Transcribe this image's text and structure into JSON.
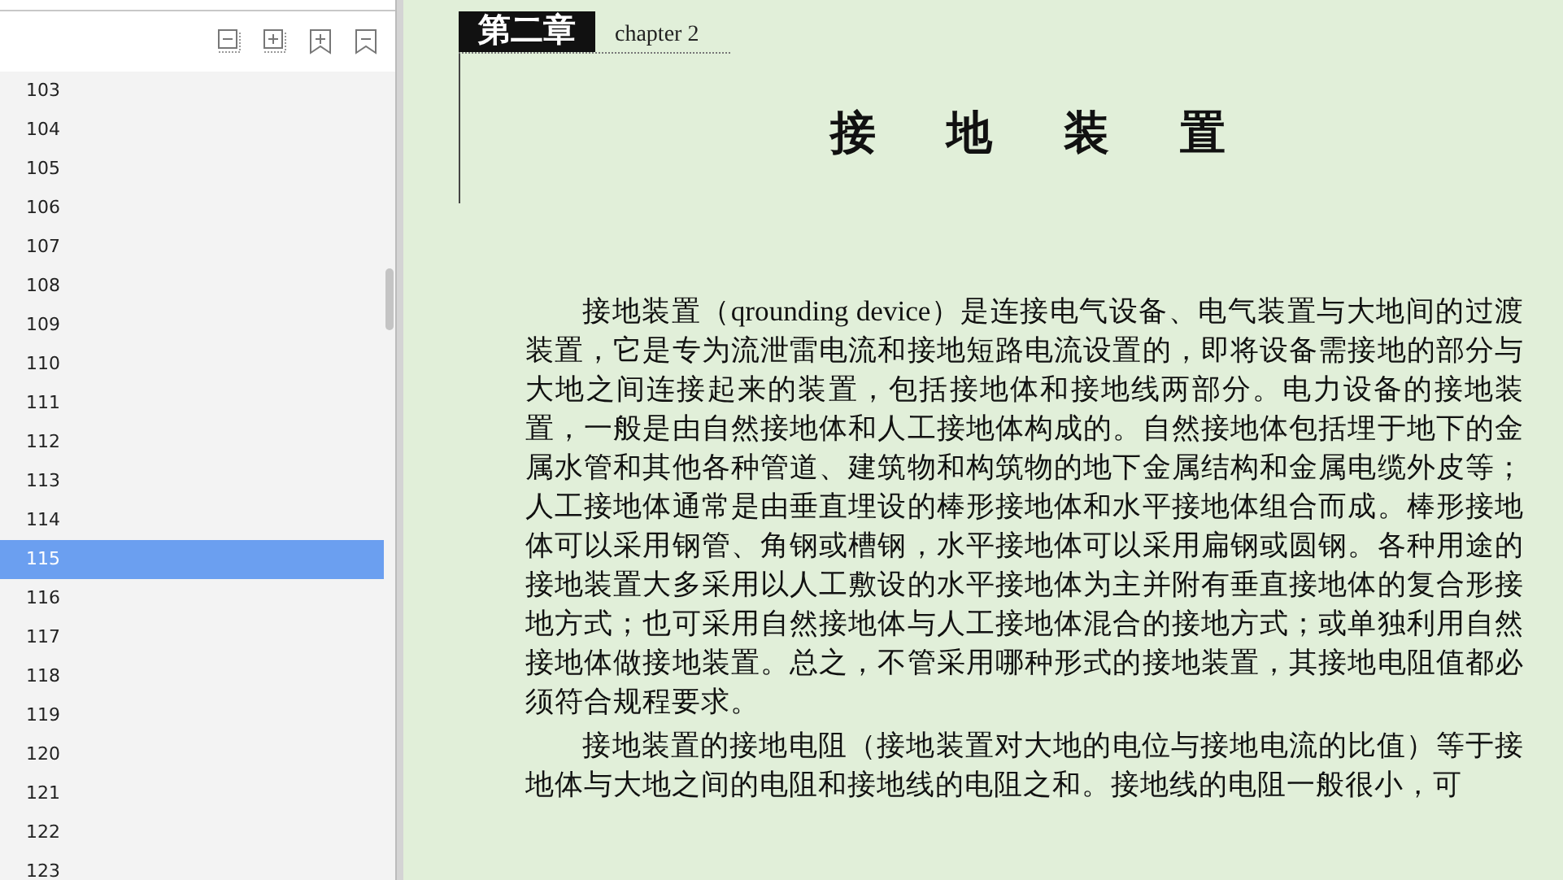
{
  "sidebar": {
    "toolbar": [
      {
        "kind": "collapse"
      },
      {
        "kind": "expand"
      },
      {
        "kind": "bookmark-add"
      },
      {
        "kind": "bookmark-remove"
      }
    ],
    "items": [
      {
        "label": "103",
        "selected": false
      },
      {
        "label": "104",
        "selected": false
      },
      {
        "label": "105",
        "selected": false
      },
      {
        "label": "106",
        "selected": false
      },
      {
        "label": "107",
        "selected": false
      },
      {
        "label": "108",
        "selected": false
      },
      {
        "label": "109",
        "selected": false
      },
      {
        "label": "110",
        "selected": false
      },
      {
        "label": "111",
        "selected": false
      },
      {
        "label": "112",
        "selected": false
      },
      {
        "label": "113",
        "selected": false
      },
      {
        "label": "114",
        "selected": false
      },
      {
        "label": "115",
        "selected": true
      },
      {
        "label": "116",
        "selected": false
      },
      {
        "label": "117",
        "selected": false
      },
      {
        "label": "118",
        "selected": false
      },
      {
        "label": "119",
        "selected": false
      },
      {
        "label": "120",
        "selected": false
      },
      {
        "label": "121",
        "selected": false
      },
      {
        "label": "122",
        "selected": false
      },
      {
        "label": "123",
        "selected": false
      }
    ]
  },
  "document": {
    "chapter_tag": "第二章",
    "chapter_label": "chapter 2",
    "title": "接 地 装 置",
    "paragraphs": [
      "接地装置（qrounding device）是连接电气设备、电气装置与大地间的过渡装置，它是专为流泄雷电流和接地短路电流设置的，即将设备需接地的部分与大地之间连接起来的装置，包括接地体和接地线两部分。电力设备的接地装置，一般是由自然接地体和人工接地体构成的。自然接地体包括埋于地下的金属水管和其他各种管道、建筑物和构筑物的地下金属结构和金属电缆外皮等；人工接地体通常是由垂直埋设的棒形接地体和水平接地体组合而成。棒形接地体可以采用钢管、角钢或槽钢，水平接地体可以采用扁钢或圆钢。各种用途的接地装置大多采用以人工敷设的水平接地体为主并附有垂直接地体的复合形接地方式；也可采用自然接地体与人工接地体混合的接地方式；或单独利用自然接地体做接地装置。总之，不管采用哪种形式的接地装置，其接地电阻值都必须符合规程要求。",
      "接地装置的接地电阻（接地装置对大地的电位与接地电流的比值）等于接地体与大地之间的电阻和接地线的电阻之和。接地线的电阻一般很小，可"
    ]
  }
}
